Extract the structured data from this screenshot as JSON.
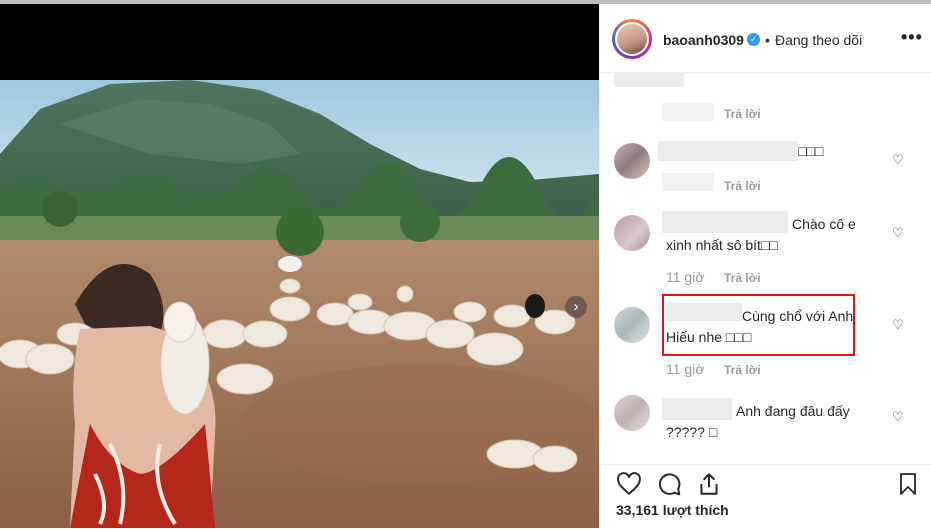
{
  "post": {
    "username": "baoanh0309",
    "separator": "•",
    "follow_status": "Đang theo dõi",
    "more_label": "•••",
    "likes": "33,161 lượt thích"
  },
  "comments": [
    {
      "text": "",
      "time": "",
      "reply": "Trả lời"
    },
    {
      "text": "□□□",
      "time": "",
      "reply": "Trả lời"
    },
    {
      "text_line1": "Chào cô e",
      "text_line2": "xinh nhất sô bít□□",
      "time": "11 giờ",
      "reply": "Trả lời"
    },
    {
      "text_line1": "Cùng chổ với Anh",
      "text_line2": "Hiếu nhe □□□",
      "time": "11 giờ",
      "reply": "Trả lời"
    },
    {
      "text_line1": "Anh đang đâu đấy",
      "text_line2": "????? □",
      "time": "",
      "reply": ""
    }
  ],
  "icons": {
    "verified": "verified-badge-icon",
    "like": "heart-icon",
    "comment": "comment-icon",
    "share": "share-icon",
    "save": "bookmark-icon",
    "next": "chevron-right-icon"
  },
  "colors": {
    "accent_blue": "#3897f0",
    "highlight_red": "#e0151b",
    "muted_text": "#999999"
  }
}
